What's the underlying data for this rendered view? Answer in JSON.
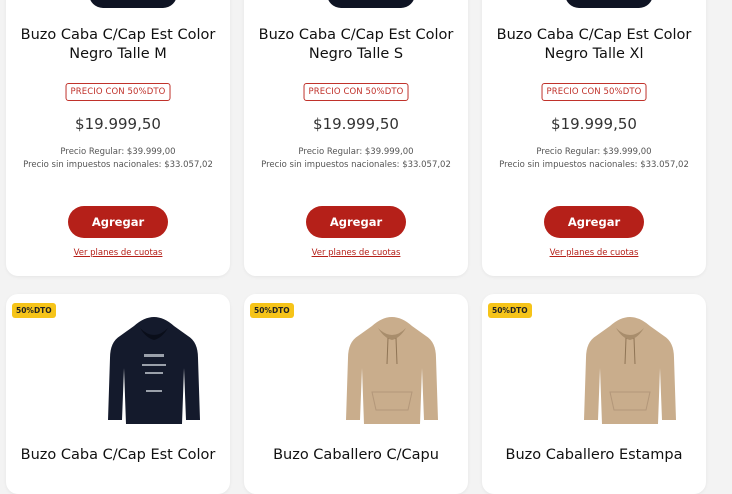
{
  "products_top": [
    {
      "title_line1": "Buzo Caba C/Cap Est Color",
      "title_line2": "Negro Talle M",
      "discount_badge": "PRECIO CON 50%DTO",
      "price": "$19.999,50",
      "regular_price": "Precio Regular: $39.999,00",
      "no_tax_price": "Precio sin impuestos nacionales: $33.057,02",
      "add_button": "Agregar",
      "installments_link": "Ver planes de cuotas"
    },
    {
      "title_line1": "Buzo Caba C/Cap Est Color",
      "title_line2": "Negro Talle S",
      "discount_badge": "PRECIO CON 50%DTO",
      "price": "$19.999,50",
      "regular_price": "Precio Regular: $39.999,00",
      "no_tax_price": "Precio sin impuestos nacionales: $33.057,02",
      "add_button": "Agregar",
      "installments_link": "Ver planes de cuotas"
    },
    {
      "title_line1": "Buzo Caba C/Cap Est Color",
      "title_line2": "Negro Talle Xl",
      "discount_badge": "PRECIO CON 50%DTO",
      "price": "$19.999,50",
      "regular_price": "Precio Regular: $39.999,00",
      "no_tax_price": "Precio sin impuestos nacionales: $33.057,02",
      "add_button": "Agregar",
      "installments_link": "Ver planes de cuotas"
    }
  ],
  "products_bottom": [
    {
      "badge": "50%DTO",
      "title_line1": "Buzo Caba C/Cap Est Color",
      "image": "black-hoodie",
      "color": "#141a2c"
    },
    {
      "badge": "50%DTO",
      "title_line1": "Buzo Caballero C/Capu",
      "image": "beige-hoodie",
      "color": "#c9ad8c"
    },
    {
      "badge": "50%DTO",
      "title_line1": "Buzo Caballero Estampa",
      "image": "beige-hoodie",
      "color": "#c9ad8c"
    }
  ],
  "colors": {
    "accent": "#b52019",
    "badge_yellow": "#f6c419"
  }
}
